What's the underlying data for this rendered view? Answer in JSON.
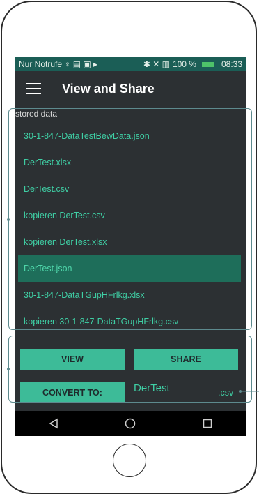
{
  "status": {
    "carrier": "Nur Notrufe",
    "left_icons": "♆ ▤ ▣ ▸",
    "right_icons": "✱ ✕ ▥",
    "battery": "100 %",
    "time": "08:33"
  },
  "appbar": {
    "title": "View and Share"
  },
  "section_label": "stored data",
  "files": [
    "30-1-847-DataTestBewData.json",
    "DerTest.xlsx",
    "DerTest.csv",
    "kopieren DerTest.csv",
    "kopieren DerTest.xlsx",
    "DerTest.json",
    "30-1-847-DataTGupHFrlkg.xlsx",
    "kopieren 30-1-847-DataTGupHFrlkg.csv"
  ],
  "selected_index": 5,
  "buttons": {
    "view": "VIEW",
    "share": "SHARE",
    "convert": "CONVERT TO:"
  },
  "convert": {
    "filename": "DerTest",
    "extension": ".csv"
  },
  "colors": {
    "accent": "#3fcfa5",
    "button": "#3dbb98",
    "statusbar": "#1b5e56",
    "background": "#2c3033",
    "selected": "#1e6e5a"
  }
}
